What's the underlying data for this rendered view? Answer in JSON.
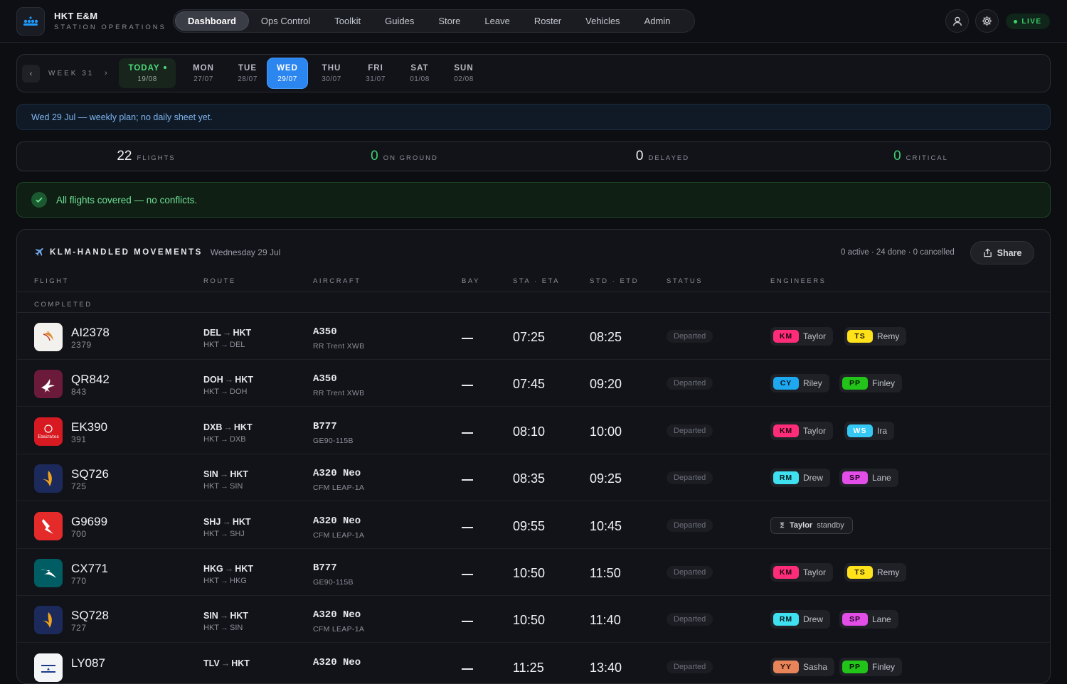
{
  "app": {
    "title": "HKT E&M",
    "subtitle": "STATION OPERATIONS",
    "live": "LIVE"
  },
  "nav": [
    "Dashboard",
    "Ops Control",
    "Toolkit",
    "Guides",
    "Store",
    "Leave",
    "Roster",
    "Vehicles",
    "Admin"
  ],
  "week": {
    "label": "WEEK 31",
    "prev": "‹",
    "next": "›"
  },
  "days": [
    {
      "name": "TODAY",
      "date": "19/08",
      "today": true
    },
    {
      "name": "MON",
      "date": "27/07"
    },
    {
      "name": "TUE",
      "date": "28/07"
    },
    {
      "name": "WED",
      "date": "29/07",
      "selected": true
    },
    {
      "name": "THU",
      "date": "30/07"
    },
    {
      "name": "FRI",
      "date": "31/07"
    },
    {
      "name": "SAT",
      "date": "01/08"
    },
    {
      "name": "SUN",
      "date": "02/08"
    }
  ],
  "notice": "Wed 29 Jul — weekly plan; no daily sheet yet.",
  "stats": [
    {
      "value": "22",
      "label": "FLIGHTS",
      "green": false
    },
    {
      "value": "0",
      "label": "ON GROUND",
      "green": true
    },
    {
      "value": "0",
      "label": "DELAYED",
      "green": false
    },
    {
      "value": "0",
      "label": "CRITICAL",
      "green": true
    }
  ],
  "ok_message": "All flights covered — no conflicts.",
  "panel": {
    "title": "KLM-HANDLED MOVEMENTS",
    "date": "Wednesday 29 Jul",
    "counts": "0 active · 24 done · 0 cancelled",
    "share": "Share",
    "columns": [
      "FLIGHT",
      "ROUTE",
      "AIRCRAFT",
      "BAY",
      "STA · ETA",
      "STD · ETD",
      "STATUS",
      "ENGINEERS"
    ],
    "group": "COMPLETED"
  },
  "flights": [
    {
      "flight": "AI2378",
      "sub": "2379",
      "in_from": "DEL",
      "in_to": "HKT",
      "out_from": "HKT",
      "out_to": "DEL",
      "ac": "A350",
      "engine": "RR Trent XWB",
      "bay": "—",
      "sta": "07:25",
      "std": "08:25",
      "status": "Departed",
      "logo": "ai",
      "engineers": [
        {
          "ini": "KM",
          "name": "Taylor",
          "bg": "#ff2d78",
          "fg": "#1a0010"
        },
        {
          "ini": "TS",
          "name": "Remy",
          "bg": "#ffe21a",
          "fg": "#1a1500"
        }
      ]
    },
    {
      "flight": "QR842",
      "sub": "843",
      "in_from": "DOH",
      "in_to": "HKT",
      "out_from": "HKT",
      "out_to": "DOH",
      "ac": "A350",
      "engine": "RR Trent XWB",
      "bay": "—",
      "sta": "07:45",
      "std": "09:20",
      "status": "Departed",
      "logo": "qr",
      "engineers": [
        {
          "ini": "CY",
          "name": "Riley",
          "bg": "#1ea8f0",
          "fg": "#001524"
        },
        {
          "ini": "PP",
          "name": "Finley",
          "bg": "#22c41a",
          "fg": "#021400"
        }
      ]
    },
    {
      "flight": "EK390",
      "sub": "391",
      "in_from": "DXB",
      "in_to": "HKT",
      "out_from": "HKT",
      "out_to": "DXB",
      "ac": "B777",
      "engine": "GE90-115B",
      "bay": "—",
      "sta": "08:10",
      "std": "10:00",
      "status": "Departed",
      "logo": "ek",
      "engineers": [
        {
          "ini": "KM",
          "name": "Taylor",
          "bg": "#ff2d78",
          "fg": "#1a0010"
        },
        {
          "ini": "WS",
          "name": "Ira",
          "bg": "#35c8f5",
          "fg": "#ffffff"
        }
      ]
    },
    {
      "flight": "SQ726",
      "sub": "725",
      "in_from": "SIN",
      "in_to": "HKT",
      "out_from": "HKT",
      "out_to": "SIN",
      "ac": "A320 Neo",
      "engine": "CFM LEAP-1A",
      "bay": "—",
      "sta": "08:35",
      "std": "09:25",
      "status": "Departed",
      "logo": "sq",
      "engineers": [
        {
          "ini": "RM",
          "name": "Drew",
          "bg": "#3fe0f0",
          "fg": "#001a1c"
        },
        {
          "ini": "SP",
          "name": "Lane",
          "bg": "#e34ee8",
          "fg": "#1a001b"
        }
      ]
    },
    {
      "flight": "G9699",
      "sub": "700",
      "in_from": "SHJ",
      "in_to": "HKT",
      "out_from": "HKT",
      "out_to": "SHJ",
      "ac": "A320 Neo",
      "engine": "CFM LEAP-1A",
      "bay": "—",
      "sta": "09:55",
      "std": "10:45",
      "status": "Departed",
      "logo": "g9",
      "standby": "Taylor",
      "standby_label": "standby",
      "engineers": []
    },
    {
      "flight": "CX771",
      "sub": "770",
      "in_from": "HKG",
      "in_to": "HKT",
      "out_from": "HKT",
      "out_to": "HKG",
      "ac": "B777",
      "engine": "GE90-115B",
      "bay": "—",
      "sta": "10:50",
      "std": "11:50",
      "status": "Departed",
      "logo": "cx",
      "engineers": [
        {
          "ini": "KM",
          "name": "Taylor",
          "bg": "#ff2d78",
          "fg": "#1a0010"
        },
        {
          "ini": "TS",
          "name": "Remy",
          "bg": "#ffe21a",
          "fg": "#1a1500"
        }
      ]
    },
    {
      "flight": "SQ728",
      "sub": "727",
      "in_from": "SIN",
      "in_to": "HKT",
      "out_from": "HKT",
      "out_to": "SIN",
      "ac": "A320 Neo",
      "engine": "CFM LEAP-1A",
      "bay": "—",
      "sta": "10:50",
      "std": "11:40",
      "status": "Departed",
      "logo": "sq",
      "engineers": [
        {
          "ini": "RM",
          "name": "Drew",
          "bg": "#3fe0f0",
          "fg": "#001a1c"
        },
        {
          "ini": "SP",
          "name": "Lane",
          "bg": "#e34ee8",
          "fg": "#1a001b"
        }
      ]
    },
    {
      "flight": "LY087",
      "sub": "",
      "in_from": "TLV",
      "in_to": "HKT",
      "out_from": "",
      "out_to": "",
      "ac": "A320 Neo",
      "engine": "",
      "bay": "—",
      "sta": "11:25",
      "std": "13:40",
      "status": "Departed",
      "logo": "ly",
      "engineers": [
        {
          "ini": "YY",
          "name": "Sasha",
          "bg": "#e8845a",
          "fg": "#2a0e00"
        },
        {
          "ini": "PP",
          "name": "Finley",
          "bg": "#22c41a",
          "fg": "#021400"
        }
      ]
    }
  ]
}
